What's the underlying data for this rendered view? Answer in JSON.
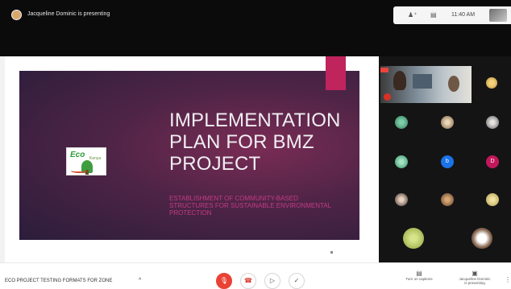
{
  "topbar": {
    "presenter_text": "Jacqueline Dominic is presenting",
    "people_icon": "people-icon",
    "chat_icon": "chat-icon",
    "time": "11:40 AM"
  },
  "slide": {
    "title_lines": [
      "IMPLEMENTATION",
      "PLAN FOR BMZ",
      "PROJECT"
    ],
    "subtitle_lines": [
      "ESTABLISHMENT OF COMMUNITY-BASED",
      "STRUCTURES FOR SUSTAINABLE ENVIRONMENTAL",
      "PROTECTION"
    ],
    "logo_text": "Eco",
    "logo_subtext": "Kenya",
    "colors": {
      "background": "#4e2446",
      "accent": "#c0245c",
      "title": "#f0eef2",
      "subtitle": "#c33b86"
    }
  },
  "participants": {
    "letters": [
      "b",
      "D"
    ],
    "colors": {
      "b": "#1a73e8",
      "D": "#c2185b",
      "mic_off": "#d93025"
    }
  },
  "bottombar": {
    "meeting_name": "ECO PROJECT TESTING FORMATS FOR ZONE",
    "caret": "^",
    "controls": {
      "mic_icon": "mic-off-icon",
      "hangup_icon": "hangup-icon",
      "camera_icon": "camera-icon",
      "present_icon": "present-icon"
    },
    "captions_label": "Turn on captions",
    "presenting_label_line1": "Jacqueline Dominic",
    "presenting_label_line2": "is presenting",
    "more_icon": "more-vert-icon"
  }
}
